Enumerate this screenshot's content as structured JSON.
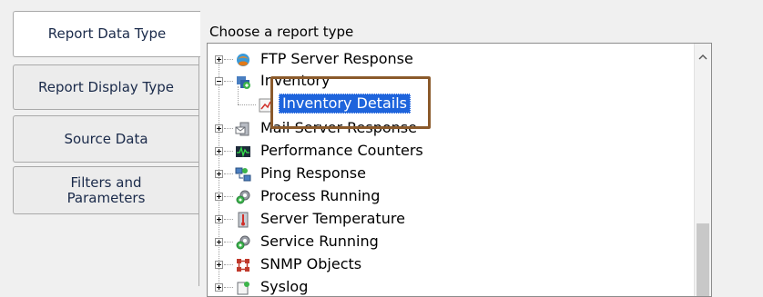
{
  "tabs": [
    {
      "label": "Report Data Type",
      "active": true
    },
    {
      "label": "Report Display Type",
      "active": false
    },
    {
      "label": "Source Data",
      "active": false
    },
    {
      "label": "Filters and Parameters",
      "active": false
    }
  ],
  "panel": {
    "title": "Choose a report type"
  },
  "tree": {
    "items": [
      {
        "label": "FTP Server Response",
        "icon": "ftp-server-icon",
        "state": "collapsed"
      },
      {
        "label": "Inventory",
        "icon": "inventory-icon",
        "state": "expanded"
      },
      {
        "label": "Inventory Details",
        "icon": "report-icon",
        "state": "leaf",
        "selected": true
      },
      {
        "label": "Mail Server Response",
        "icon": "mail-server-icon",
        "state": "collapsed"
      },
      {
        "label": "Performance Counters",
        "icon": "performance-icon",
        "state": "collapsed"
      },
      {
        "label": "Ping Response",
        "icon": "ping-icon",
        "state": "collapsed"
      },
      {
        "label": "Process Running",
        "icon": "process-icon",
        "state": "collapsed"
      },
      {
        "label": "Server Temperature",
        "icon": "temperature-icon",
        "state": "collapsed"
      },
      {
        "label": "Service Running",
        "icon": "service-icon",
        "state": "collapsed"
      },
      {
        "label": "SNMP Objects",
        "icon": "snmp-icon",
        "state": "collapsed"
      },
      {
        "label": "Syslog",
        "icon": "syslog-icon",
        "state": "collapsed"
      }
    ]
  },
  "colors": {
    "selection": "#1e64dc",
    "highlight_box": "#8b5a2b"
  }
}
